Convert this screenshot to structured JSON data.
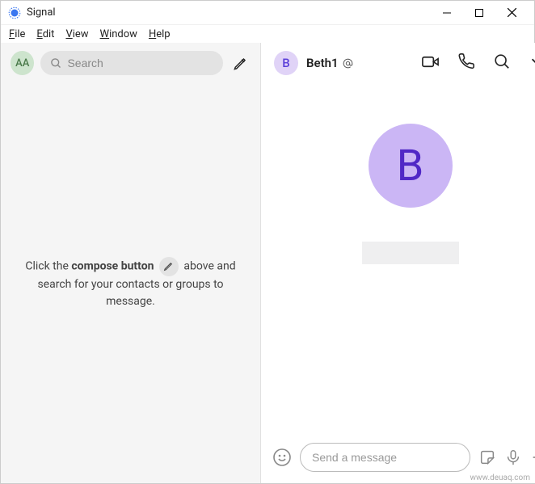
{
  "window": {
    "title": "Signal"
  },
  "menu": {
    "file": "File",
    "edit": "Edit",
    "view": "View",
    "window": "Window",
    "help": "Help"
  },
  "sidebar": {
    "self_initials": "AA",
    "search_placeholder": "Search",
    "hint_pre": "Click the ",
    "hint_bold": "compose button",
    "hint_post": " above and search for your contacts or groups to message."
  },
  "conversation": {
    "contact_initial": "B",
    "contact_name": "Beth1",
    "big_initial": "B"
  },
  "composer": {
    "placeholder": "Send a message"
  },
  "watermark": "www.deuaq.com"
}
